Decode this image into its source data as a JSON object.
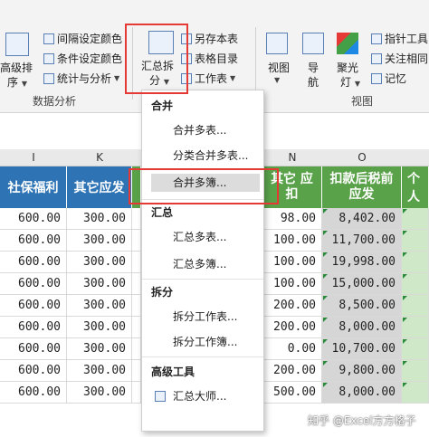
{
  "ribbon": {
    "sort_label1": "高级排",
    "sort_label2": "序",
    "interval_color": "间隔设定颜色",
    "cond_color": "条件设定颜色",
    "stats": "统计与分析",
    "data_analysis": "数据分析",
    "merge_split_label1": "汇总拆",
    "merge_split_label2": "分",
    "save_as_table": "另存本表",
    "table_dir": "表格目录",
    "worksheet": "工作表",
    "view_btn": "视图",
    "nav_label1": "导",
    "nav_label2": "航",
    "spotlight_label1": "聚光",
    "spotlight_label2": "灯",
    "view_group": "视图",
    "pointer_tool": "指针工具",
    "related_cells": "关注相同",
    "memory": "记忆"
  },
  "columns": {
    "i": "I",
    "k": "K",
    "n": "N",
    "o": "O"
  },
  "headers": {
    "social": "社保福利",
    "other_deduct": "其它应发",
    "other_withhold_1": "其它 应",
    "other_withhold_2": "扣",
    "after_deduct_1": "扣款后税前",
    "after_deduct_2": "应发",
    "personal": "个人"
  },
  "rows": [
    {
      "i": "600.00",
      "k": "300.00",
      "n": "98.00",
      "o": "8,402.00"
    },
    {
      "i": "600.00",
      "k": "300.00",
      "n": "100.00",
      "o": "11,700.00"
    },
    {
      "i": "600.00",
      "k": "300.00",
      "n": "100.00",
      "o": "19,998.00"
    },
    {
      "i": "600.00",
      "k": "300.00",
      "n": "100.00",
      "o": "15,000.00"
    },
    {
      "i": "600.00",
      "k": "300.00",
      "n": "200.00",
      "o": "8,500.00"
    },
    {
      "i": "600.00",
      "k": "300.00",
      "n": "200.00",
      "o": "8,000.00"
    },
    {
      "i": "600.00",
      "k": "300.00",
      "n": "0.00",
      "o": "10,700.00"
    },
    {
      "i": "600.00",
      "k": "300.00",
      "n": "200.00",
      "o": "9,800.00"
    },
    {
      "i": "600.00",
      "k": "300.00",
      "n": "500.00",
      "o": "8,000.00"
    }
  ],
  "menu": {
    "sec_merge": "合并",
    "merge_tables": "合并多表...",
    "classified_merge": "分类合并多表...",
    "merge_books": "合并多簿...",
    "sec_summary": "汇总",
    "summary_tables": "汇总多表...",
    "summary_books": "汇总多簿...",
    "sec_split": "拆分",
    "split_sheets": "拆分工作表...",
    "split_books": "拆分工作簿...",
    "sec_advanced": "高级工具",
    "summary_master": "汇总大师..."
  },
  "watermark": "知乎 @Excel方方格子",
  "colors": {
    "header_blue": "#2e74b5",
    "header_green": "#5aa24a",
    "highlight_red": "#e53935"
  }
}
